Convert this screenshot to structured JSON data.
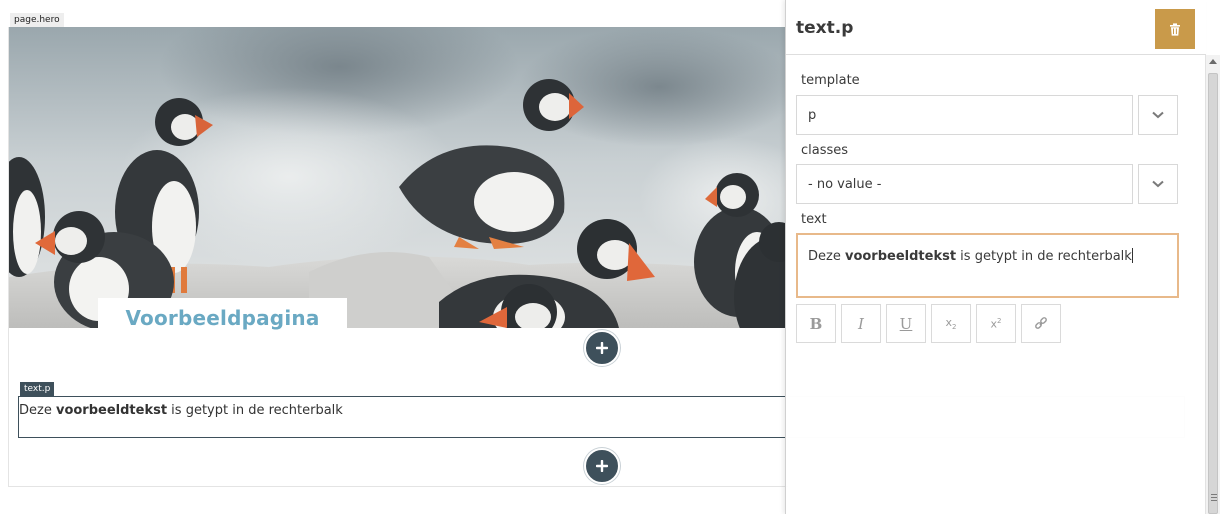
{
  "canvas": {
    "hero_tag": "page.hero",
    "hero_title": "Voorbeeldpagina",
    "text_tag": "text.p",
    "text_block": {
      "before": "Deze ",
      "bold": "voorbeeldtekst",
      "after": " is getypt in de rechterbalk"
    }
  },
  "sidebar": {
    "title": "text.p",
    "fields": {
      "template_label": "template",
      "template_value": "p",
      "classes_label": "classes",
      "classes_value": "- no value -",
      "text_label": "text"
    },
    "text_value": {
      "before": "Deze ",
      "bold": "voorbeeldtekst",
      "after": " is getypt in de rechterbalk"
    },
    "toolbar": [
      "bold",
      "italic",
      "underline",
      "subscript",
      "superscript",
      "link"
    ]
  },
  "colors": {
    "accent_dark": "#3e505b",
    "delete_button": "#c99a4a",
    "hero_title": "#6aa9c3",
    "focus_border": "#e8b98a"
  },
  "icons": [
    "plus-icon",
    "trash-icon",
    "chevron-down-icon",
    "link-icon"
  ]
}
